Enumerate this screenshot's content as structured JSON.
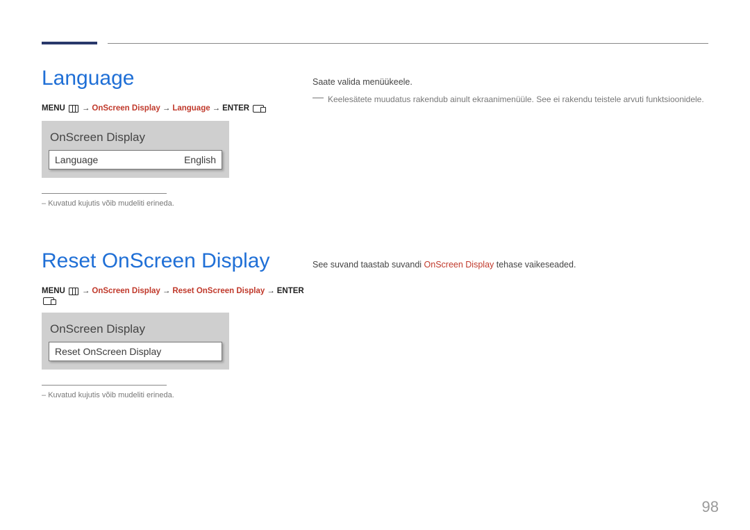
{
  "page_number": "98",
  "section1": {
    "title": "Language",
    "path": {
      "menu": "MENU",
      "crumb1": "OnScreen Display",
      "crumb2": "Language",
      "enter": "ENTER"
    },
    "osd": {
      "title": "OnScreen Display",
      "row_label": "Language",
      "row_value": "English"
    },
    "footnote": "Kuvatud kujutis võib mudeliti erineda.",
    "desc_line": "Saate valida menüükeele.",
    "desc_note": "Keelesätete muudatus rakendub ainult ekraanimenüüle. See ei rakendu teistele arvuti funktsioonidele."
  },
  "section2": {
    "title": "Reset OnScreen Display",
    "path": {
      "menu": "MENU",
      "crumb1": "OnScreen Display",
      "crumb2": "Reset OnScreen Display",
      "enter": "ENTER"
    },
    "osd": {
      "title": "OnScreen Display",
      "row_label": "Reset OnScreen Display"
    },
    "footnote": "Kuvatud kujutis võib mudeliti erineda.",
    "desc_pre": "See suvand taastab suvandi ",
    "desc_red": "OnScreen Display",
    "desc_post": " tehase vaikeseaded."
  }
}
